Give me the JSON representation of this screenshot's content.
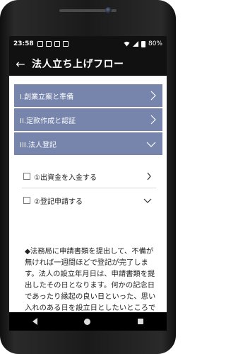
{
  "status": {
    "time": "23:58",
    "battery": "80%"
  },
  "appbar": {
    "back_icon": "←",
    "title": "法人立ち上げフロー"
  },
  "sections": [
    {
      "label": "I.創業立案と準備"
    },
    {
      "label": "II.定款作成と認証"
    },
    {
      "label": "III.法人登記"
    }
  ],
  "tasks": [
    {
      "label": "①出資金を入金する"
    },
    {
      "label": "②登記申請する"
    }
  ],
  "detail_text": "◆法務局に申請書類を提出して、不備が無ければ一週間ほどで登記が完了します。法人の設立年月日は、申請書類を提出したその日となります。何かの記念日であったり縁起の良い日といった、思い入れのある日を設立日としたいところです。但し、土日、祝祭日や年末年始は窓"
}
